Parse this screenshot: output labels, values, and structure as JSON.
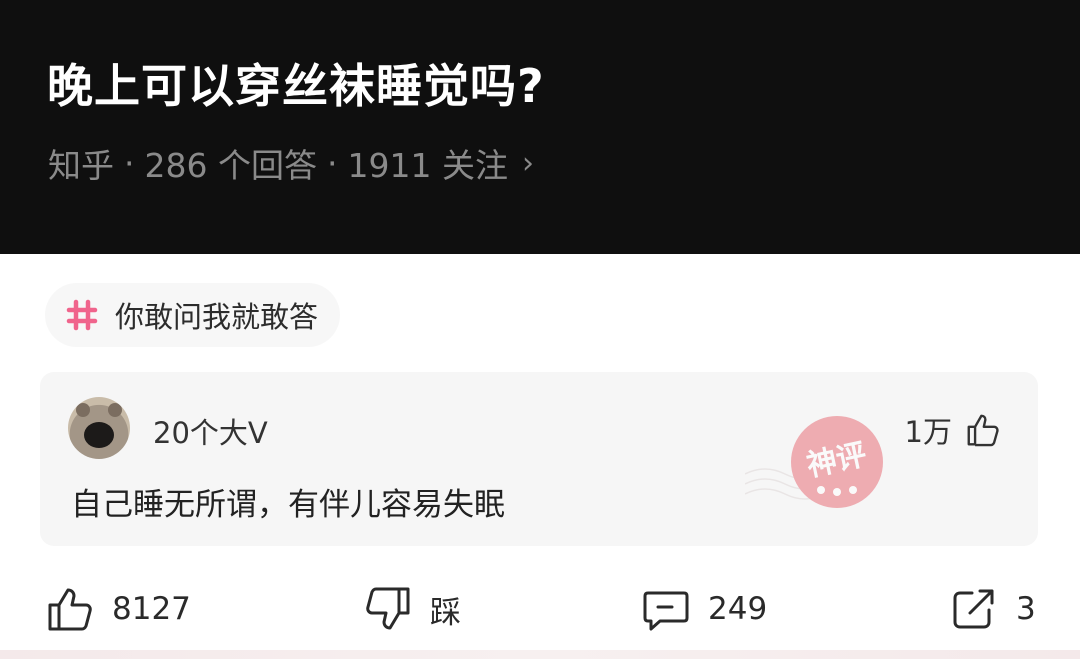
{
  "question": {
    "title": "晚上可以穿丝袜睡觉吗?",
    "source": "知乎",
    "answers": "286 个回答",
    "followers": "1911 关注",
    "separator": "·",
    "chevron": "›"
  },
  "topic": {
    "icon": "hashtag-icon",
    "label": "你敢问我就敢答"
  },
  "answer_card": {
    "author": "20个大V",
    "likes": "1万",
    "text": "自己睡无所谓，有伴儿容易失眠",
    "stamp_text": "神评"
  },
  "actions": {
    "like_count": "8127",
    "dislike_label": "踩",
    "comment_count": "249",
    "share_count": "3"
  },
  "colors": {
    "header_bg": "#0f0f0f",
    "hashtag": "#f0648c",
    "stamp": "#e8707a"
  }
}
